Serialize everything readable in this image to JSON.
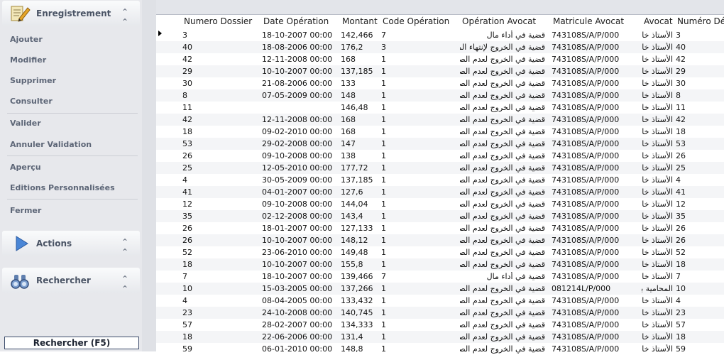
{
  "sidebar": {
    "enregistrement": {
      "title": "Enregistrement",
      "items": [
        "Ajouter",
        "Modifier",
        "Supprimer",
        "Consulter",
        "Valider",
        "Annuler Validation",
        "Aperçu",
        "Editions Personnalisées",
        "Fermer"
      ]
    },
    "actions": {
      "title": "Actions"
    },
    "rechercher": {
      "title": "Rechercher"
    },
    "search_button": "Rechercher (F5)"
  },
  "grid": {
    "columns": [
      "Numero Dossier",
      "Date Opération",
      "Montant",
      "Code Opération",
      "Opération Avocat",
      "Matricule Avocat",
      "Avocat",
      "Numéro Dé"
    ],
    "rows": [
      [
        "3",
        "18-10-2007 00:00",
        "142,466",
        "7",
        "قضية في أداء مال",
        "743108S/A/P/000",
        "الأستاذ خا",
        "3"
      ],
      [
        "40",
        "18-08-2006 00:00",
        "176,2",
        "3",
        "قضية في الخروج لإنتهاء المدة",
        "743108S/A/P/000",
        "الأستاذ خا",
        "40"
      ],
      [
        "42",
        "12-11-2008 00:00",
        "168",
        "1",
        "قضية في الخروج لعدم الصفة",
        "743108S/A/P/000",
        "الأستاذ خا",
        "42"
      ],
      [
        "29",
        "10-10-2007 00:00",
        "137,185",
        "1",
        "قضية في الخروج لعدم الصفة",
        "743108S/A/P/000",
        "الأستاذ خا",
        "29"
      ],
      [
        "30",
        "21-08-2006 00:00",
        "133",
        "1",
        "قضية في الخروج لعدم الصفة",
        "743108S/A/P/000",
        "الأستاذ خا",
        "30"
      ],
      [
        "8",
        "07-05-2009 00:00",
        "148",
        "1",
        "قضية في الخروج لعدم الصفة",
        "743108S/A/P/000",
        "الأستاذ خا",
        "8"
      ],
      [
        "11",
        "",
        "146,48",
        "1",
        "قضية في الخروج لعدم الصفة",
        "743108S/A/P/000",
        "الأستاذ خا",
        "11"
      ],
      [
        "42",
        "12-11-2008 00:00",
        "168",
        "1",
        "قضية في الخروج لعدم الصفة",
        "743108S/A/P/000",
        "الأستاذ خا",
        "42"
      ],
      [
        "18",
        "09-02-2010 00:00",
        "168",
        "1",
        "قضية في الخروج لعدم الصفة",
        "743108S/A/P/000",
        "الأستاذ خا",
        "18"
      ],
      [
        "53",
        "29-02-2008 00:00",
        "147",
        "1",
        "قضية في الخروج لعدم الصفة",
        "743108S/A/P/000",
        "الأستاذ خا",
        "53"
      ],
      [
        "26",
        "09-10-2008 00:00",
        "138",
        "1",
        "قضية في الخروج لعدم الصفة",
        "743108S/A/P/000",
        "الأستاذ خا",
        "26"
      ],
      [
        "25",
        "12-05-2010 00:00",
        "177,72",
        "1",
        "قضية في الخروج لعدم الصفة",
        "743108S/A/P/000",
        "الأستاذ خا",
        "25"
      ],
      [
        "4",
        "30-05-2009 00:00",
        "137,185",
        "1",
        "قضية في الخروج لعدم الصفة",
        "743108S/A/P/000",
        "الأستاذ خا",
        "4"
      ],
      [
        "41",
        "04-01-2007 00:00",
        "127,6",
        "1",
        "قضية في الخروج لعدم الصفة",
        "743108S/A/P/000",
        "الأستاذ خا",
        "41"
      ],
      [
        "12",
        "09-10-2008 00:00",
        "144,04",
        "1",
        "قضية في الخروج لعدم الصفة",
        "743108S/A/P/000",
        "الأستاذ خا",
        "12"
      ],
      [
        "35",
        "02-12-2008 00:00",
        "143,4",
        "1",
        "قضية في الخروج لعدم الصفة",
        "743108S/A/P/000",
        "الأستاذ خا",
        "35"
      ],
      [
        "26",
        "18-01-2007 00:00",
        "127,133",
        "1",
        "قضية في الخروج لعدم الصفة",
        "743108S/A/P/000",
        "الأستاذ خا",
        "26"
      ],
      [
        "26",
        "10-10-2007 00:00",
        "148,12",
        "1",
        "قضية في الخروج لعدم الصفة",
        "743108S/A/P/000",
        "الأستاذ خا",
        "26"
      ],
      [
        "52",
        "23-06-2010 00:00",
        "149,48",
        "1",
        "قضية في الخروج لعدم الصفة",
        "743108S/A/P/000",
        "الأستاذ خا",
        "52"
      ],
      [
        "18",
        "10-10-2007 00:00",
        "155,8",
        "1",
        "قضية في الخروج لعدم الصفة",
        "743108S/A/P/000",
        "الأستاذ خا",
        "18"
      ],
      [
        "7",
        "18-10-2007 00:00",
        "139,466",
        "7",
        "قضية في أداء مال",
        "743108S/A/P/000",
        "الأستاذ خا",
        "7"
      ],
      [
        "10",
        "15-03-2005 00:00",
        "137,266",
        "1",
        "قضية في الخروج لعدم الصفة",
        "081214L/P/000",
        "المحامية بث",
        "10"
      ],
      [
        "4",
        "08-04-2005 00:00",
        "133,432",
        "1",
        "قضية في الخروج لعدم الصفة",
        "743108S/A/P/000",
        "الأستاذ خا",
        "4"
      ],
      [
        "23",
        "24-10-2008 00:00",
        "140,745",
        "1",
        "قضية في الخروج لعدم الصفة",
        "743108S/A/P/000",
        "الأستاذ خا",
        "23"
      ],
      [
        "57",
        "28-02-2007 00:00",
        "134,333",
        "1",
        "قضية في الخروج لعدم الصفة",
        "743108S/A/P/000",
        "الأستاذ خا",
        "57"
      ],
      [
        "18",
        "22-06-2006 00:00",
        "131,4",
        "1",
        "قضية في الخروج لعدم الصفة",
        "743108S/A/P/000",
        "الأستاذ خا",
        "18"
      ],
      [
        "59",
        "06-01-2010 00:00",
        "148,8",
        "1",
        "قضية في الخروج لعدم الصفة",
        "743108S/A/P/000",
        "الأستاذ خا",
        "59"
      ]
    ]
  },
  "colors": {
    "sidebar_bg": "#e7e8ec",
    "menu_text": "#5d6677",
    "alt_row": "#f4f5f7"
  }
}
